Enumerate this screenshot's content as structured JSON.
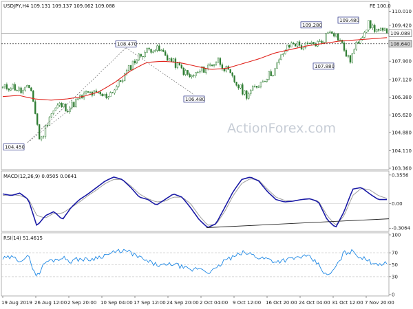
{
  "chart_data": [
    {
      "type": "candlestick",
      "title": "USDJPY,H4 109.131 109.137 109.062 109.088",
      "top_right_label": "FE 100.0",
      "watermark": "ActionForex.com",
      "ylim": [
        103.36,
        110.09
      ],
      "y_ticks": [
        "110.010",
        "109.420",
        "108.640",
        "107.900",
        "107.120",
        "106.380",
        "105.620",
        "104.880",
        "104.110",
        "103.360"
      ],
      "price_box_current": "109.088",
      "price_box_level": "108.640",
      "x_tick_labels": [
        "19 Aug 2019",
        "26 Aug 12:00",
        "2 Sep 20:00",
        "10 Sep 04:00",
        "17 Sep 12:00",
        "24 Sep 20:00",
        "2 Oct 04:00",
        "9 Oct 12:00",
        "16 Oct 20:00",
        "24 Oct 04:00",
        "31 Oct 12:00",
        "7 Nov 20:00"
      ],
      "price_waypoints": [
        106.75,
        106.85,
        106.6,
        106.8,
        104.45,
        105.6,
        106.05,
        105.9,
        106.25,
        106.55,
        106.5,
        106.4,
        106.75,
        107.3,
        107.9,
        108.25,
        108.47,
        108.3,
        107.9,
        107.6,
        107.2,
        107.45,
        107.7,
        107.95,
        107.45,
        106.9,
        106.48,
        106.8,
        107.2,
        107.5,
        108.3,
        108.7,
        108.5,
        108.6,
        108.7,
        109.28,
        108.8,
        107.88,
        108.8,
        109.48,
        109.2,
        109.088
      ],
      "ma_waypoints": [
        106.4,
        106.45,
        106.3,
        106.25,
        106.3,
        106.4,
        106.6,
        107.0,
        107.5,
        107.85,
        107.9,
        107.85,
        107.7,
        107.55,
        107.6,
        107.8,
        108.0,
        108.25,
        108.4,
        108.55,
        108.65,
        108.75,
        108.8,
        108.85,
        108.9
      ],
      "annotations": [
        {
          "label": "104.450",
          "value": 104.45
        },
        {
          "label": "108.470",
          "value": 108.47
        },
        {
          "label": "106.480",
          "value": 106.48
        },
        {
          "label": "109.280",
          "value": 109.28
        },
        {
          "label": "107.880",
          "value": 107.88
        },
        {
          "label": "109.480",
          "value": 109.48
        }
      ],
      "horizontal_lines": [
        108.64,
        109.088
      ],
      "colors": {
        "price": "#2e7d32",
        "ma": "#e1231c",
        "annotation_box": "#1a237e",
        "trendline": "#222222"
      }
    },
    {
      "type": "line",
      "title": "MACD(12,26,9) 0.0505 0.0641",
      "ylim": [
        -0.33,
        0.38
      ],
      "y_ticks": [
        "0.3556",
        "0.00",
        "-0.3064"
      ],
      "macd_waypoints": [
        0.12,
        0.1,
        0.13,
        0.05,
        -0.28,
        -0.15,
        -0.1,
        -0.2,
        -0.05,
        0.05,
        0.12,
        0.2,
        0.28,
        0.33,
        0.3,
        0.2,
        0.08,
        0.05,
        -0.02,
        0.05,
        0.12,
        0.08,
        -0.05,
        -0.2,
        -0.3,
        -0.25,
        -0.05,
        0.15,
        0.3,
        0.33,
        0.28,
        0.15,
        0.05,
        0.02,
        0.03,
        0.05,
        0.06,
        0.02,
        -0.2,
        -0.3,
        -0.1,
        0.18,
        0.2,
        0.12,
        0.05,
        0.05
      ],
      "signal_waypoints": [
        0.1,
        0.11,
        0.1,
        0.06,
        -0.15,
        -0.18,
        -0.12,
        -0.12,
        -0.05,
        0.02,
        0.1,
        0.17,
        0.25,
        0.3,
        0.3,
        0.22,
        0.12,
        0.06,
        0.02,
        0.03,
        0.08,
        0.08,
        0.0,
        -0.15,
        -0.27,
        -0.26,
        -0.1,
        0.1,
        0.25,
        0.31,
        0.29,
        0.18,
        0.08,
        0.04,
        0.03,
        0.05,
        0.06,
        0.03,
        -0.15,
        -0.27,
        -0.15,
        0.1,
        0.19,
        0.17,
        0.1,
        0.064
      ],
      "trendline": [
        -0.3,
        -0.19
      ],
      "colors": {
        "macd": "#1a1aa6",
        "signal": "#9e9e9e"
      }
    },
    {
      "type": "line",
      "title": "RSI(14) 51.4615",
      "ylim": [
        0,
        100
      ],
      "y_ticks": [
        "100",
        "70",
        "50",
        "30",
        "0"
      ],
      "rsi_waypoints": [
        60,
        62,
        58,
        63,
        30,
        55,
        58,
        62,
        56,
        60,
        58,
        62,
        66,
        70,
        74,
        70,
        62,
        55,
        50,
        48,
        52,
        46,
        40,
        45,
        38,
        42,
        58,
        62,
        70,
        68,
        62,
        60,
        55,
        58,
        60,
        64,
        62,
        50,
        30,
        45,
        70,
        72,
        62,
        55,
        52,
        51.46
      ],
      "colors": {
        "rsi": "#1e88e5",
        "levels": "#bdbdbd"
      }
    }
  ]
}
